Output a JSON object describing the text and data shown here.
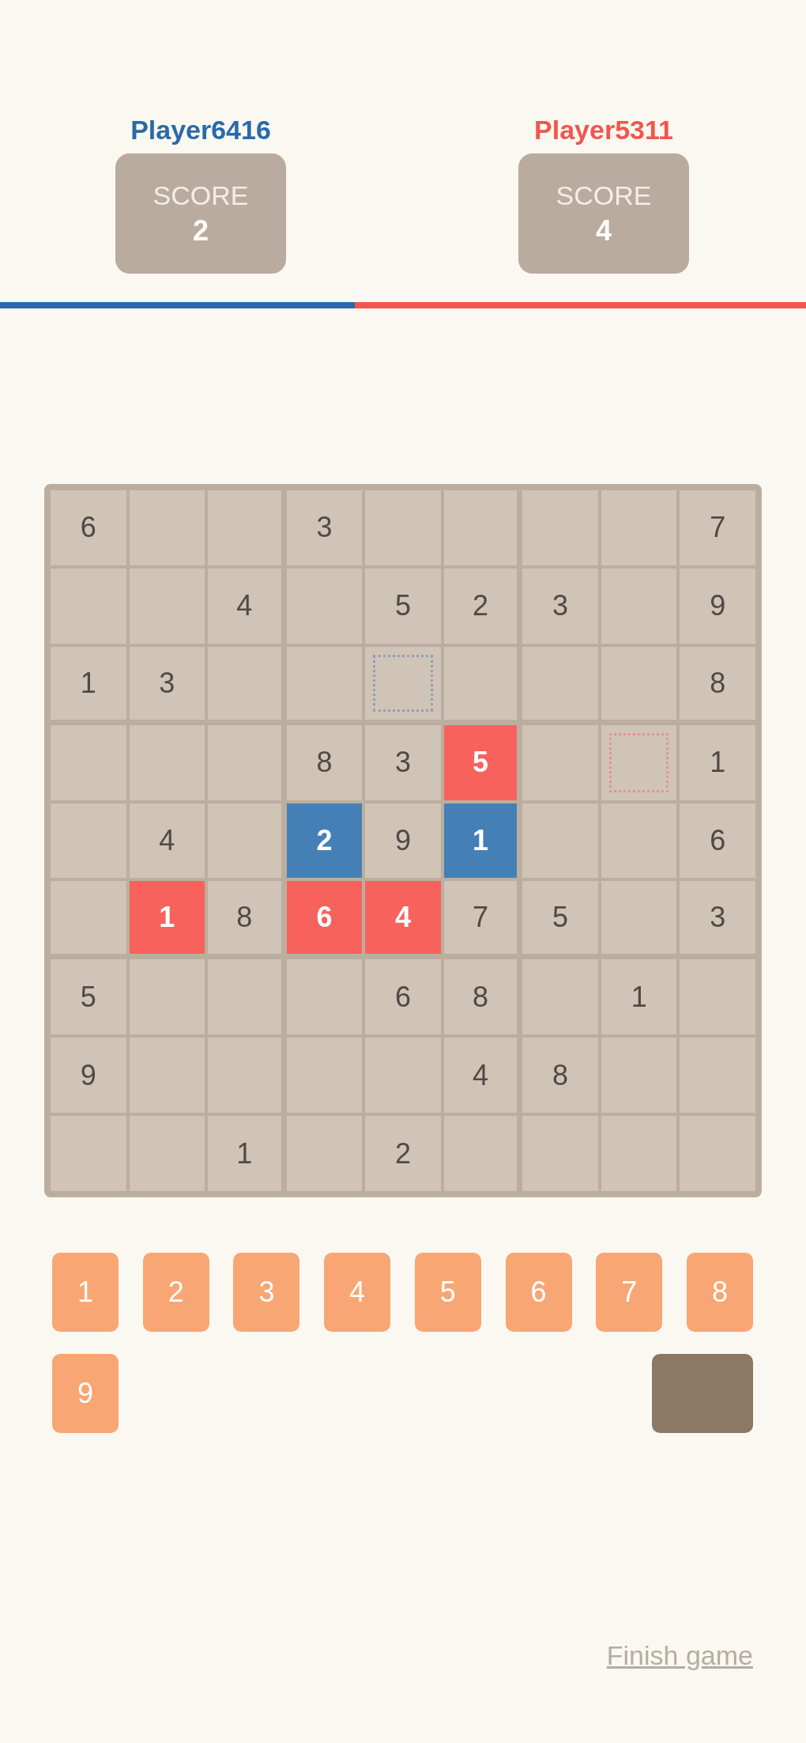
{
  "players": [
    {
      "name": "Player6416",
      "color": "#2a6aa8",
      "score_label": "SCORE",
      "score": "2"
    },
    {
      "name": "Player5311",
      "color": "#f2554d",
      "score_label": "SCORE",
      "score": "4"
    }
  ],
  "progress": {
    "level": 0.44
  },
  "grid": [
    [
      {
        "kind": "given",
        "value": "6"
      },
      {
        "kind": "empty"
      },
      {
        "kind": "empty"
      },
      {
        "kind": "given",
        "value": "3"
      },
      {
        "kind": "empty"
      },
      {
        "kind": "empty"
      },
      {
        "kind": "empty"
      },
      {
        "kind": "empty"
      },
      {
        "kind": "given",
        "value": "7"
      }
    ],
    [
      {
        "kind": "empty"
      },
      {
        "kind": "empty"
      },
      {
        "kind": "given",
        "value": "4"
      },
      {
        "kind": "empty"
      },
      {
        "kind": "given",
        "value": "5"
      },
      {
        "kind": "given",
        "value": "2"
      },
      {
        "kind": "given",
        "value": "3"
      },
      {
        "kind": "empty"
      },
      {
        "kind": "given",
        "value": "9"
      }
    ],
    [
      {
        "kind": "given",
        "value": "1"
      },
      {
        "kind": "given",
        "value": "3"
      },
      {
        "kind": "empty"
      },
      {
        "kind": "empty"
      },
      {
        "kind": "cursor_player1"
      },
      {
        "kind": "empty"
      },
      {
        "kind": "empty"
      },
      {
        "kind": "empty"
      },
      {
        "kind": "given",
        "value": "8"
      }
    ],
    [
      {
        "kind": "empty"
      },
      {
        "kind": "empty"
      },
      {
        "kind": "empty"
      },
      {
        "kind": "given",
        "value": "8"
      },
      {
        "kind": "given",
        "value": "3"
      },
      {
        "kind": "player2",
        "value": "5"
      },
      {
        "kind": "empty"
      },
      {
        "kind": "cursor_player2"
      },
      {
        "kind": "given",
        "value": "1"
      }
    ],
    [
      {
        "kind": "empty"
      },
      {
        "kind": "given",
        "value": "4"
      },
      {
        "kind": "empty"
      },
      {
        "kind": "player1",
        "value": "2"
      },
      {
        "kind": "given",
        "value": "9"
      },
      {
        "kind": "player1",
        "value": "1"
      },
      {
        "kind": "empty"
      },
      {
        "kind": "empty"
      },
      {
        "kind": "given",
        "value": "6"
      }
    ],
    [
      {
        "kind": "empty"
      },
      {
        "kind": "player2",
        "value": "1"
      },
      {
        "kind": "given",
        "value": "8"
      },
      {
        "kind": "player2",
        "value": "6"
      },
      {
        "kind": "player2",
        "value": "4"
      },
      {
        "kind": "given",
        "value": "7"
      },
      {
        "kind": "given",
        "value": "5"
      },
      {
        "kind": "empty"
      },
      {
        "kind": "given",
        "value": "3"
      }
    ],
    [
      {
        "kind": "given",
        "value": "5"
      },
      {
        "kind": "empty"
      },
      {
        "kind": "empty"
      },
      {
        "kind": "empty"
      },
      {
        "kind": "given",
        "value": "6"
      },
      {
        "kind": "given",
        "value": "8"
      },
      {
        "kind": "empty"
      },
      {
        "kind": "given",
        "value": "1"
      },
      {
        "kind": "empty"
      }
    ],
    [
      {
        "kind": "given",
        "value": "9"
      },
      {
        "kind": "empty"
      },
      {
        "kind": "empty"
      },
      {
        "kind": "empty"
      },
      {
        "kind": "empty"
      },
      {
        "kind": "given",
        "value": "4"
      },
      {
        "kind": "given",
        "value": "8"
      },
      {
        "kind": "empty"
      },
      {
        "kind": "empty"
      }
    ],
    [
      {
        "kind": "empty"
      },
      {
        "kind": "empty"
      },
      {
        "kind": "given",
        "value": "1"
      },
      {
        "kind": "empty"
      },
      {
        "kind": "given",
        "value": "2"
      },
      {
        "kind": "empty"
      },
      {
        "kind": "empty"
      },
      {
        "kind": "empty"
      },
      {
        "kind": "empty"
      }
    ]
  ],
  "keypad": [
    {
      "kind": "digit",
      "label": "1"
    },
    {
      "kind": "digit",
      "label": "2"
    },
    {
      "kind": "digit",
      "label": "3"
    },
    {
      "kind": "digit",
      "label": "4"
    },
    {
      "kind": "digit",
      "label": "5"
    },
    {
      "kind": "digit",
      "label": "6"
    },
    {
      "kind": "digit",
      "label": "7"
    },
    {
      "kind": "digit",
      "label": "8"
    },
    {
      "kind": "digit",
      "label": "9"
    },
    {
      "kind": "blank"
    }
  ],
  "finish_link": "Finish game"
}
